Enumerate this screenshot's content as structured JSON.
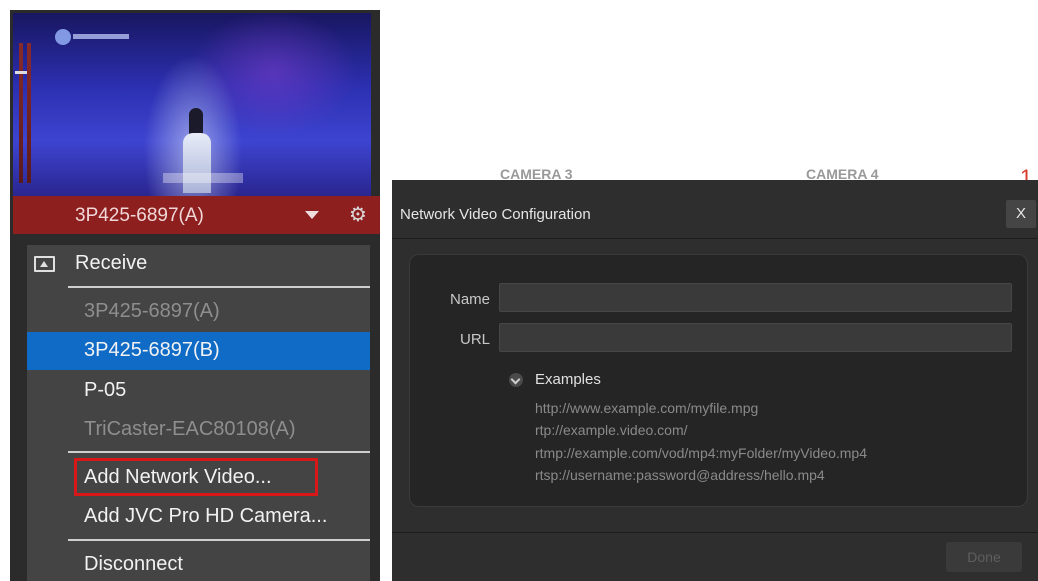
{
  "source": {
    "name": "3P425-6897(A)"
  },
  "menu": {
    "receive_label": "Receive",
    "items": [
      {
        "label": "3P425-6897(A)",
        "state": "disabled"
      },
      {
        "label": "3P425-6897(B)",
        "state": "selected"
      },
      {
        "label": "P-05",
        "state": "normal"
      },
      {
        "label": "TriCaster-EAC80108(A)",
        "state": "disabled"
      }
    ],
    "actions": [
      {
        "label": "Add Network Video..."
      },
      {
        "label": "Add JVC Pro HD Camera..."
      }
    ],
    "disconnect_label": "Disconnect"
  },
  "background": {
    "camera3": "CAMERA 3",
    "camera4": "CAMERA 4"
  },
  "dialog": {
    "title": "Network Video Configuration",
    "close_label": "X",
    "name_label": "Name",
    "name_value": "",
    "url_label": "URL",
    "url_value": "",
    "examples_label": "Examples",
    "examples": [
      "http://www.example.com/myfile.mpg",
      "rtp://example.video.com/",
      "rtmp://example.com/vod/mp4:myFolder/myVideo.mp4",
      "rtsp://username:password@address/hello.mp4"
    ],
    "done_label": "Done"
  },
  "colors": {
    "source_bar": "#8e1f1f",
    "selected_item": "#0f6bc6",
    "highlight_box": "#d81818"
  }
}
